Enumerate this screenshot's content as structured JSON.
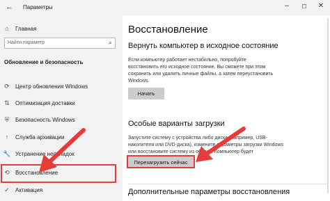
{
  "window": {
    "title": "Параметры",
    "back_glyph": "←",
    "minimize_glyph": "–",
    "maximize_glyph": "☐",
    "close_glyph": "✕"
  },
  "sidebar": {
    "home_label": "Главная",
    "home_icon": "⌂",
    "search_placeholder": "Найти параметр",
    "search_icon": "⌕",
    "section_title": "Обновление и безопасность",
    "items": [
      {
        "label": "Центр обновления Windows",
        "icon": "⟳"
      },
      {
        "label": "Оптимизация доставки",
        "icon": "⇅"
      },
      {
        "label": "Безопасность Windows",
        "icon": "⛨"
      },
      {
        "label": "Служба архивации",
        "icon": "↑"
      },
      {
        "label": "Устранение неполадок",
        "icon": "🔧"
      },
      {
        "label": "Восстановление",
        "icon": "⟲"
      },
      {
        "label": "Активация",
        "icon": "✓"
      }
    ]
  },
  "main": {
    "title": "Восстановление",
    "reset": {
      "heading": "Вернуть компьютер в исходное состояние",
      "description": "Если компьютер работает нестабильно, попробуйте\nвосстановить его исходное состояние. Вы сможете при этом\nсохранить или удалить личные файлы, а затем переустановить\nWindows.",
      "button_label": "Начать"
    },
    "special_boot": {
      "heading": "Особые варианты загрузки",
      "description": "Запустите систему с устройства либо диска (например, USB-\nнакопителя или DVD-диска), измените параметры загрузки Windows\nили восстановите систему из образа. Компьютер будет перезагружен.",
      "button_label": "Перезагрузить сейчас"
    },
    "more_heading": "Дополнительные параметры восстановления"
  },
  "annotation_color": "#e63b3b"
}
